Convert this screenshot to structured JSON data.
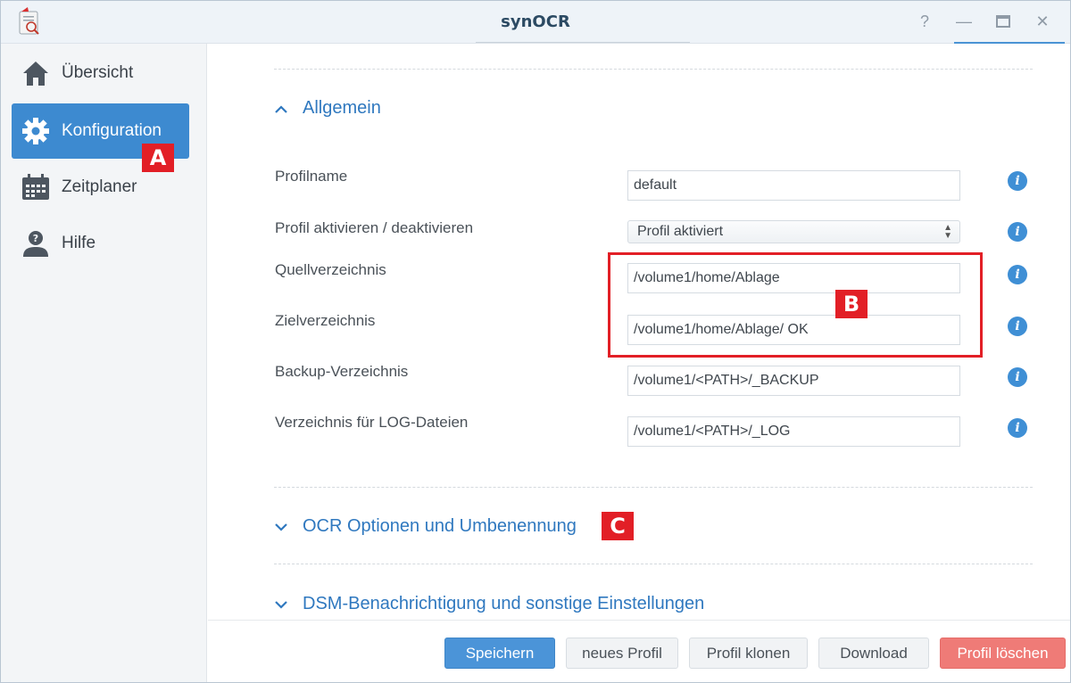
{
  "window": {
    "title": "synOCR"
  },
  "sidebar": {
    "items": [
      {
        "label": "Übersicht",
        "icon": "home-icon"
      },
      {
        "label": "Konfiguration",
        "icon": "gear-icon"
      },
      {
        "label": "Zeitplaner",
        "icon": "calendar-icon"
      },
      {
        "label": "Hilfe",
        "icon": "help-person-icon"
      }
    ]
  },
  "markers": {
    "a": "A",
    "b": "B",
    "c": "C"
  },
  "sections": {
    "allgemein": "Allgemein",
    "ocr": "OCR Optionen und Umbenennung",
    "dsm": "DSM-Benachrichtigung und sonstige Einstellungen"
  },
  "form": {
    "profilname_label": "Profilname",
    "profilname_value": "default",
    "aktivieren_label": "Profil aktivieren / deaktivieren",
    "aktivieren_value": "Profil aktiviert",
    "quell_label": "Quellverzeichnis",
    "quell_value": "/volume1/home/Ablage",
    "ziel_label": "Zielverzeichnis",
    "ziel_value": "/volume1/home/Ablage/ OK",
    "backup_label": "Backup-Verzeichnis",
    "backup_value": "/volume1/<PATH>/_BACKUP",
    "log_label": "Verzeichnis für LOG-Dateien",
    "log_value": "/volume1/<PATH>/_LOG"
  },
  "footer": {
    "save": "Speichern",
    "new_profile": "neues Profil",
    "clone": "Profil klonen",
    "download": "Download",
    "delete": "Profil löschen"
  },
  "colors": {
    "accent": "#3d8ad0",
    "marker": "#e21f26",
    "danger": "#ef7b77"
  }
}
